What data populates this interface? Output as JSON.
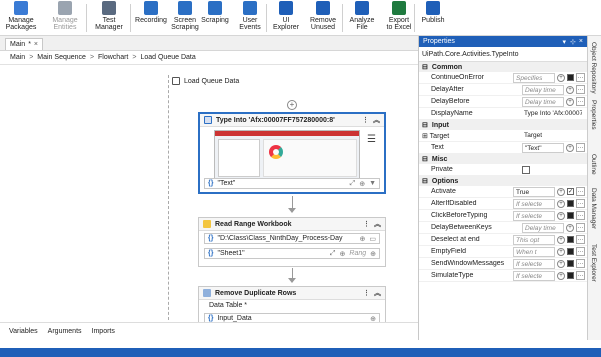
{
  "ribbon": {
    "buttons": [
      {
        "label": "Manage\nPackages",
        "icon": "package-icon",
        "color": "#3a7bd5",
        "disabled": false
      },
      {
        "label": "Manage\nEntities",
        "icon": "entities-icon",
        "color": "#9aa4b0",
        "disabled": true
      },
      {
        "label": "Test\nManager",
        "icon": "test-manager-icon",
        "color": "#5a6a80",
        "disabled": false
      },
      {
        "label": "Recording",
        "icon": "recording-icon",
        "color": "#2b6fc4",
        "disabled": false
      },
      {
        "label": "Screen\nScraping",
        "icon": "screen-scraping-icon",
        "color": "#2b6fc4",
        "disabled": false
      },
      {
        "label": "Scraping",
        "icon": "data-scraping-icon",
        "color": "#2b6fc4",
        "disabled": false
      },
      {
        "label": "User\nEvents",
        "icon": "user-events-icon",
        "color": "#2b6fc4",
        "disabled": false
      },
      {
        "label": "UI\nExplorer",
        "icon": "ui-explorer-icon",
        "color": "#1f5fb8",
        "disabled": false
      },
      {
        "label": "Remove\nUnused",
        "icon": "remove-unused-icon",
        "color": "#1f5fb8",
        "disabled": false
      },
      {
        "label": "Analyze\nFile",
        "icon": "analyze-file-icon",
        "color": "#1f5fb8",
        "disabled": false
      },
      {
        "label": "Export\nto Excel",
        "icon": "excel-icon",
        "color": "#1f7a3f",
        "disabled": false
      },
      {
        "label": "Publish",
        "icon": "publish-icon",
        "color": "#1f5fb8",
        "disabled": false
      }
    ]
  },
  "tab": {
    "label": "Main",
    "modified": "*",
    "close": "×"
  },
  "breadcrumbs": [
    "Main",
    "Main Sequence",
    "Flowchart",
    "Load Queue Data"
  ],
  "canvas": {
    "sequence_title": "Load Queue Data",
    "activities": [
      {
        "title": "Type Into 'Afx:00007FF757280000:8'",
        "field_label": "Text",
        "required": "*",
        "value": "\"Text\""
      },
      {
        "title": "Read Range Workbook",
        "path_value": "\"D:\\Class\\Class_NinthDay_Process-Day",
        "sheet_value": "\"Sheet1\"",
        "range_placeholder": "Rang"
      },
      {
        "title": "Remove Duplicate Rows",
        "field_label": "Data Table",
        "required": "*",
        "value": "Input_Data"
      }
    ]
  },
  "bottom_tabs": [
    "Variables",
    "Arguments",
    "Imports"
  ],
  "properties": {
    "panel_title": "Properties",
    "type_name": "UiPath.Core.Activities.TypeInto",
    "categories": [
      {
        "name": "Common",
        "rows": [
          {
            "name": "ContinueOnError",
            "value": "Specifies",
            "placeholder": true,
            "buttons": "sq"
          },
          {
            "name": "DelayAfter",
            "value": "Delay time",
            "placeholder": true,
            "buttons": "plus"
          },
          {
            "name": "DelayBefore",
            "value": "Delay time",
            "placeholder": true,
            "buttons": "plus"
          },
          {
            "name": "DisplayName",
            "value": "Type Into 'Afx:00007",
            "placeholder": false,
            "buttons": "none"
          }
        ]
      },
      {
        "name": "Input",
        "rows": [
          {
            "name": "Target",
            "value": "Target",
            "placeholder": false,
            "buttons": "none",
            "expandable": true
          },
          {
            "name": "Text",
            "value": "\"Text\"",
            "placeholder": false,
            "buttons": "plus"
          }
        ]
      },
      {
        "name": "Misc",
        "rows": [
          {
            "name": "Private",
            "value": "",
            "placeholder": false,
            "buttons": "checkbox"
          }
        ]
      },
      {
        "name": "Options",
        "rows": [
          {
            "name": "Activate",
            "value": "True",
            "placeholder": false,
            "buttons": "sq-checked"
          },
          {
            "name": "AlterIfDisabled",
            "value": "If selecte",
            "placeholder": true,
            "buttons": "sq"
          },
          {
            "name": "ClickBeforeTyping",
            "value": "If selecte",
            "placeholder": true,
            "buttons": "sq"
          },
          {
            "name": "DelayBetweenKeys",
            "value": "Delay time",
            "placeholder": true,
            "buttons": "plus"
          },
          {
            "name": "Deselect at end",
            "value": "This opt",
            "placeholder": true,
            "buttons": "sq"
          },
          {
            "name": "EmptyField",
            "value": "When t",
            "placeholder": true,
            "buttons": "sq"
          },
          {
            "name": "SendWindowMessages",
            "value": "If selecte",
            "placeholder": true,
            "buttons": "sq"
          },
          {
            "name": "SimulateType",
            "value": "If selecte",
            "placeholder": true,
            "buttons": "sq"
          }
        ]
      }
    ]
  },
  "side_strip": [
    "Object Repository",
    "Properties",
    "Outline",
    "Data Manager",
    "Test Explorer"
  ],
  "colors": {
    "accent": "#1f5fb8",
    "selected_border": "#2b6fc4"
  }
}
